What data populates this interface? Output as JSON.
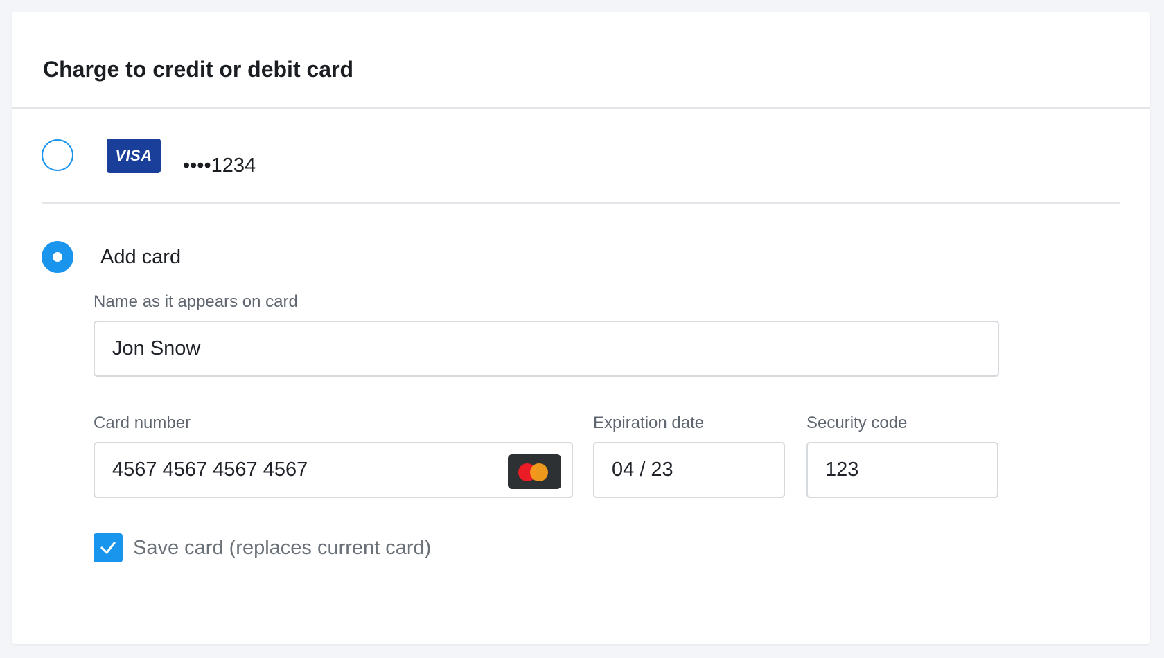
{
  "title": "Charge to credit or debit card",
  "saved_card": {
    "brand": "VISA",
    "masked_number": "••••1234",
    "selected": false
  },
  "add_card": {
    "label": "Add card",
    "selected": true
  },
  "form": {
    "name_label": "Name as it appears on card",
    "name_value": "Jon Snow",
    "card_number_label": "Card number",
    "card_number_value": "4567 4567 4567 4567",
    "card_brand_icon": "mastercard-icon",
    "expiration_label": "Expiration date",
    "expiration_value": "04 / 23",
    "security_label": "Security code",
    "security_value": "123",
    "save_card_label": "Save card (replaces current card)",
    "save_card_checked": true
  },
  "colors": {
    "accent": "#1a95ee",
    "visa_bg": "#1a3f9a",
    "mastercard_bg": "#2e3133"
  }
}
